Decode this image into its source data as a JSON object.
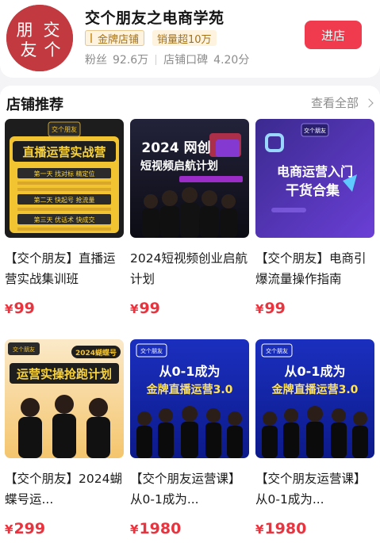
{
  "shop": {
    "name": "交个朋友之电商学苑",
    "logo_text": [
      "交",
      "个",
      "朋",
      "友"
    ],
    "badge_gold": "金牌店铺",
    "badge_sales": "销量超10万",
    "fans_label": "粉丝",
    "fans_value": "92.6万",
    "rating_label": "店铺口碑",
    "rating_value": "4.20分",
    "enter_label": "进店"
  },
  "section": {
    "title": "店铺推荐",
    "see_all": "查看全部"
  },
  "products": [
    {
      "title": "【交个朋友】直播运营实战集训班",
      "price": "99",
      "thumb": {
        "brand": "交个朋友",
        "headline": "直播运营实战营",
        "rows": [
          "第一天 找对标 精定位",
          "第二天 快起号 抢流量",
          "第三天 优话术 快成交"
        ]
      }
    },
    {
      "title": "2024短视频创业启航计划",
      "price": "99",
      "thumb": {
        "brand": "交个朋友",
        "headline_1": "2024 网创",
        "headline_2": "短视频启航计划"
      }
    },
    {
      "title": "【交个朋友】电商引爆流量操作指南",
      "price": "99",
      "thumb": {
        "brand": "交个朋友",
        "headline_1": "电商运营入门",
        "headline_2": "干货合集"
      }
    },
    {
      "title": "【交个朋友】2024蝴蝶号运...",
      "price": "299",
      "thumb": {
        "brand": "交个朋友",
        "tag": "2024蝴蝶号",
        "headline": "运营实操抢跑计划"
      }
    },
    {
      "title": "【交个朋友运营课】从0-1成为...",
      "price": "1980",
      "thumb": {
        "brand": "交个朋友",
        "headline_1": "从0-1成为",
        "headline_2": "金牌直播运营3.0"
      }
    },
    {
      "title": "【交个朋友运营课】从0-1成为...",
      "price": "1980",
      "thumb": {
        "brand": "交个朋友",
        "headline_1": "从0-1成为",
        "headline_2": "金牌直播运营3.0"
      }
    }
  ],
  "currency": "¥",
  "colors": {
    "accent": "#f03a4e",
    "price": "#e8343f",
    "gold_text": "#a57117",
    "gold_bg": "#fdf3df",
    "logo_bg": "#c23a3f"
  },
  "icons": {
    "chevron": "chevron-right-icon",
    "badge": "crown-icon"
  }
}
